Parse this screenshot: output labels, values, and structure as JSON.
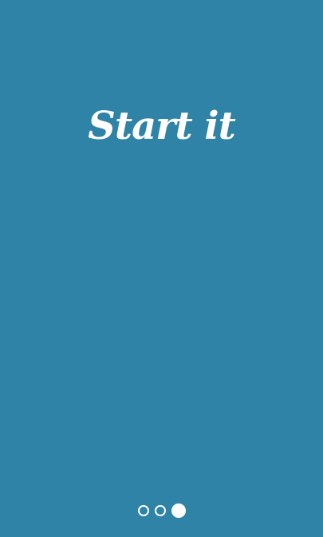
{
  "onboarding": {
    "headline": "Start it",
    "background_color": "#2e83a6",
    "text_color": "#ffffff"
  },
  "pager": {
    "total_pages": 3,
    "current_page": 3
  }
}
